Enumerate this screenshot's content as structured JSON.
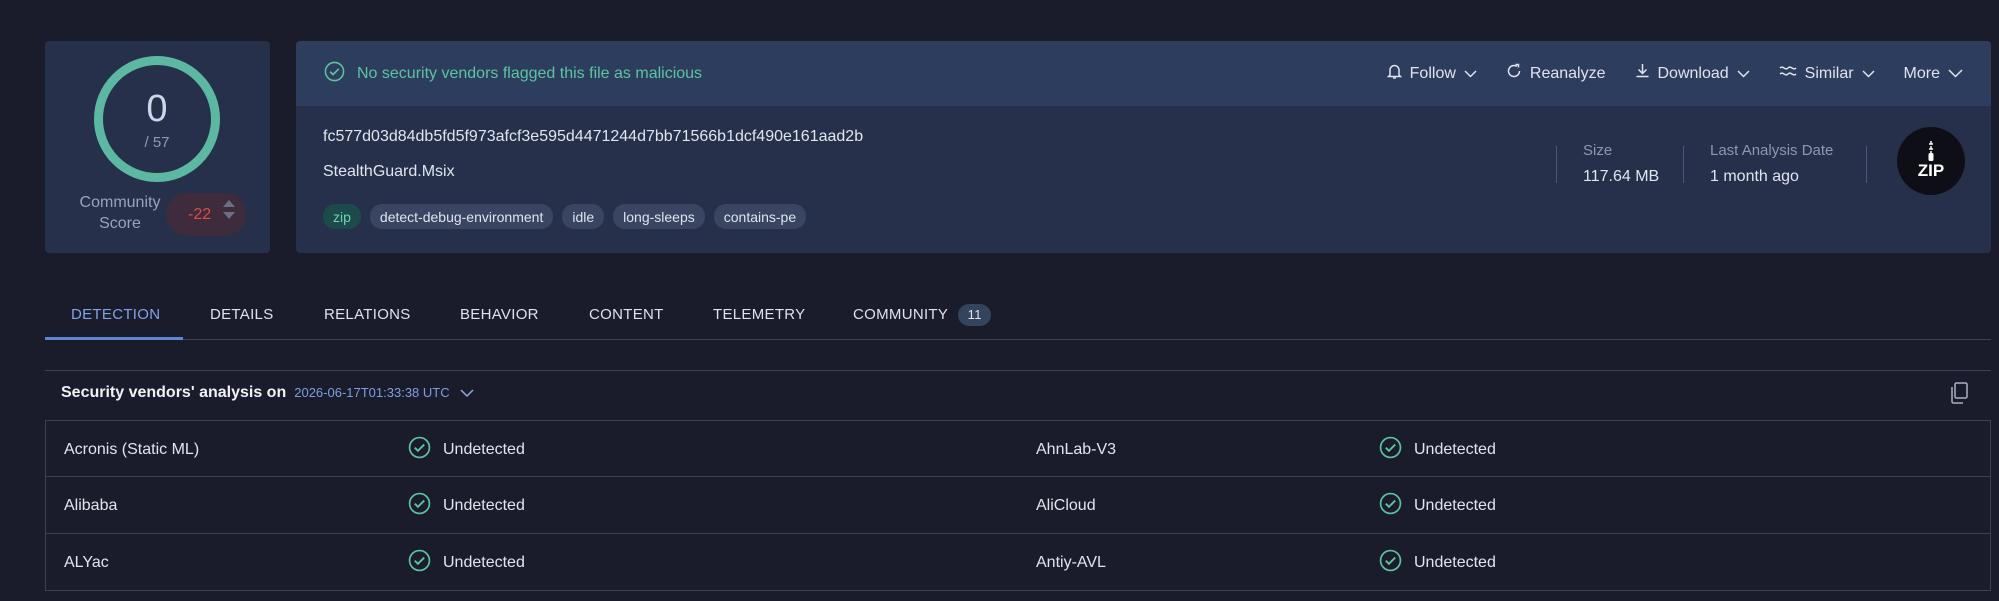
{
  "score": {
    "detections": "0",
    "total": "/ 57",
    "community_label": "Community Score",
    "community_value": "-22"
  },
  "status_message": "No security vendors flagged this file as malicious",
  "actions": {
    "follow": "Follow",
    "reanalyze": "Reanalyze",
    "download": "Download",
    "similar": "Similar",
    "more": "More"
  },
  "file": {
    "hash": "fc577d03d84db5fd5f973afcf3e595d4471244d7bb71566b1dcf490e161aad2b",
    "name": "StealthGuard.Msix",
    "tags": [
      "zip",
      "detect-debug-environment",
      "idle",
      "long-sleeps",
      "contains-pe"
    ],
    "size_label": "Size",
    "size_value": "117.64 MB",
    "date_label": "Last Analysis Date",
    "date_value": "1 month ago",
    "type_icon_text": "ZIP"
  },
  "tabs": [
    "DETECTION",
    "DETAILS",
    "RELATIONS",
    "BEHAVIOR",
    "CONTENT",
    "TELEMETRY",
    "COMMUNITY"
  ],
  "community_count": "11",
  "analysis": {
    "title": "Security vendors' analysis on",
    "date": "2026-06-17T01:33:38 UTC"
  },
  "vendors": [
    {
      "left": "Acronis (Static ML)",
      "left_status": "Undetected",
      "right": "AhnLab-V3",
      "right_status": "Undetected"
    },
    {
      "left": "Alibaba",
      "left_status": "Undetected",
      "right": "AliCloud",
      "right_status": "Undetected"
    },
    {
      "left": "ALYac",
      "left_status": "Undetected",
      "right": "Antiy-AVL",
      "right_status": "Undetected"
    }
  ],
  "colors": {
    "accent": "#5f86d4",
    "ok": "#5cc4a0",
    "negative": "#e04b4b",
    "card": "#26304a",
    "background": "#1b1c2b"
  }
}
